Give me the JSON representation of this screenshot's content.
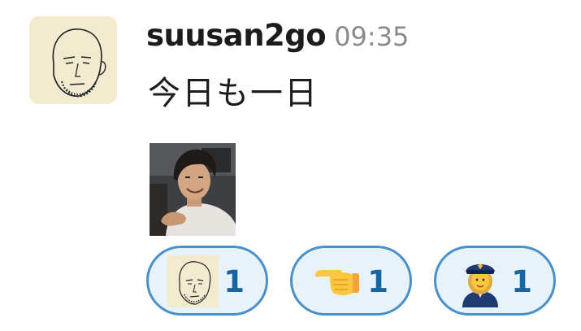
{
  "message": {
    "username": "suusan2go",
    "timestamp": "09:35",
    "text": "今日も一日",
    "avatar_icon": "sketch-face-avatar",
    "attachment_icon": "person-photo"
  },
  "reactions": [
    {
      "emoji_name": "custom-sketch-face-emoji",
      "count": "1"
    },
    {
      "emoji_name": "point-left-emoji",
      "count": "1"
    },
    {
      "emoji_name": "police-officer-emoji",
      "count": "1"
    }
  ],
  "colors": {
    "reaction_border": "#4a90c8",
    "reaction_bg": "#e8f2f9",
    "reaction_count": "#1a64a0",
    "username": "#1d1c1d",
    "timestamp": "#8b8a8b"
  }
}
